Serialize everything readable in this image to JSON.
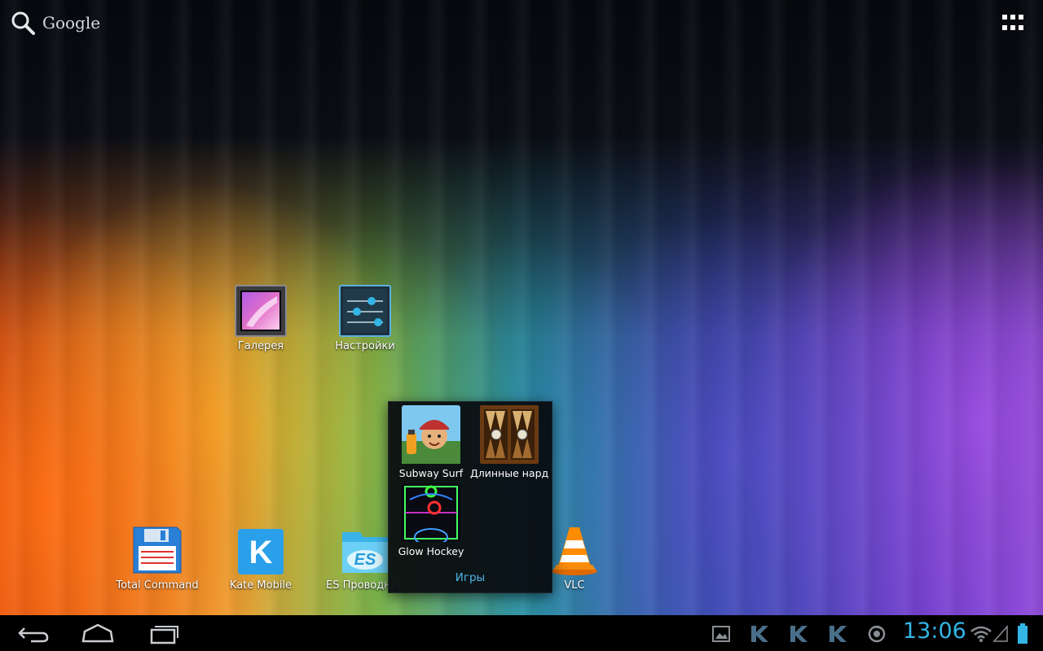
{
  "search": {
    "label": "Google"
  },
  "desktop_icons": [
    {
      "name": "Галерея"
    },
    {
      "name": "Настройки"
    }
  ],
  "dock_icons": [
    {
      "name": "Total Command"
    },
    {
      "name": "Kate Mobile"
    },
    {
      "name": "ES Проводник"
    },
    {
      "name": "VLC"
    }
  ],
  "folder": {
    "name": "Игры",
    "items": [
      {
        "name": "Subway Surf"
      },
      {
        "name": "Длинные нарды"
      },
      {
        "name": "Glow Hockey"
      }
    ]
  },
  "status_bar": {
    "time": "13:06",
    "notification_icons": [
      "gallery-notification-icon",
      "kate-k-icon",
      "kate-k-icon",
      "kate-k-icon",
      "firefox-icon"
    ],
    "system_icons": [
      "wifi-icon",
      "signal-icon",
      "battery-icon"
    ]
  },
  "colors": {
    "accent": "#33b5e5",
    "folder_title": "#4fb6e8",
    "navbar": "#000000"
  }
}
